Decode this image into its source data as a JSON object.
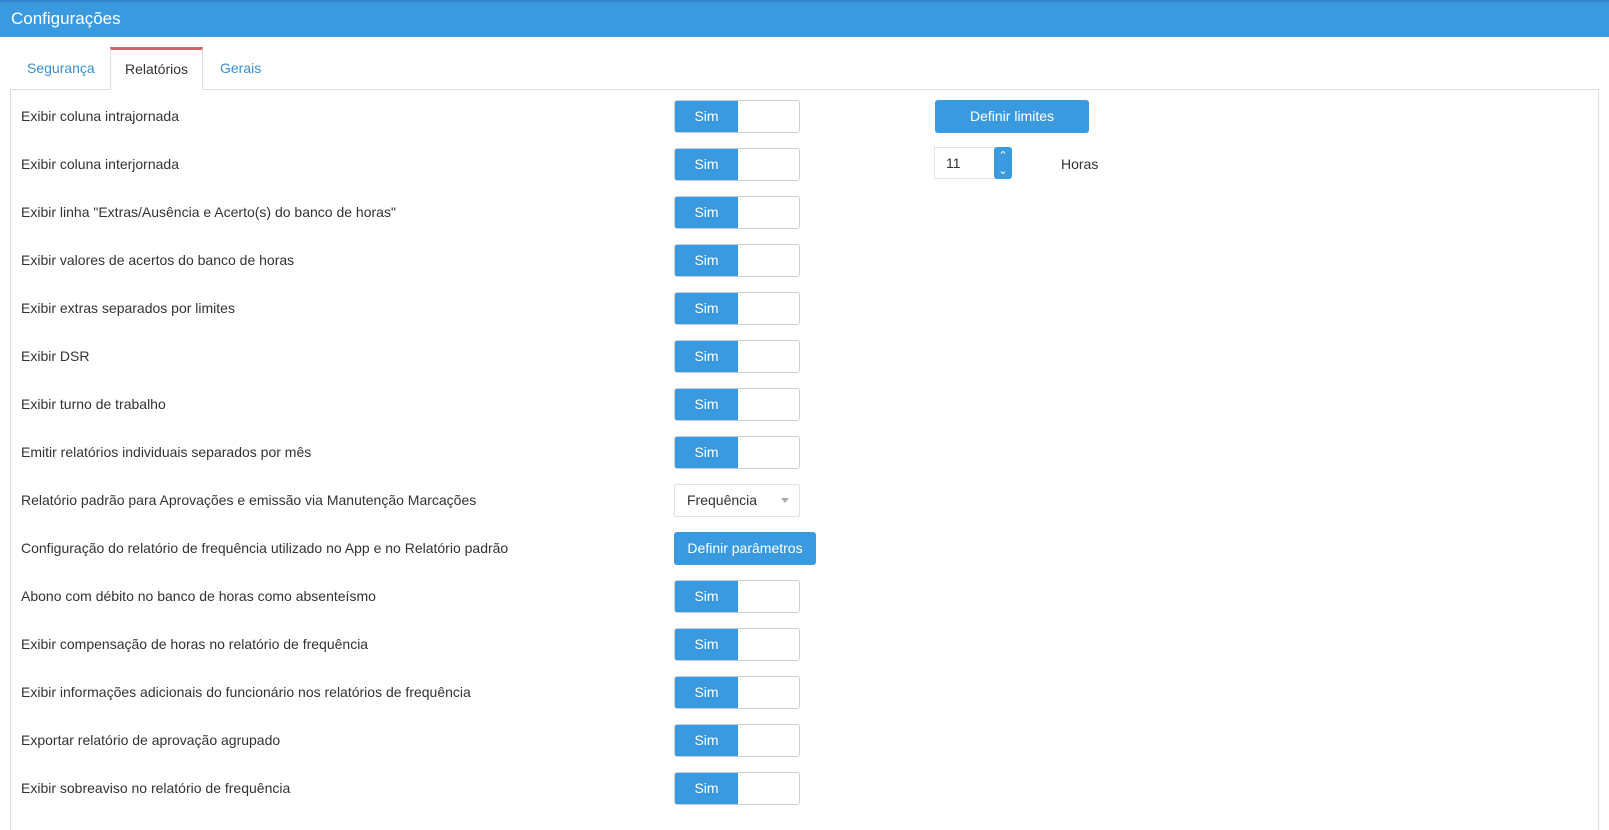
{
  "header": {
    "title": "Configurações"
  },
  "tabs": [
    {
      "label": "Segurança"
    },
    {
      "label": "Relatórios"
    },
    {
      "label": "Gerais"
    }
  ],
  "rows": [
    {
      "label": "Exibir coluna intrajornada",
      "toggle": "Sim",
      "extra_button": "Definir limites"
    },
    {
      "label": "Exibir coluna interjornada",
      "toggle": "Sim",
      "hours_value": "11",
      "hours_unit": "Horas"
    },
    {
      "label": "Exibir linha \"Extras/Ausência e Acerto(s) do banco de horas\"",
      "toggle": "Sim"
    },
    {
      "label": "Exibir valores de acertos do banco de horas",
      "toggle": "Sim"
    },
    {
      "label": "Exibir extras separados por limites",
      "toggle": "Sim"
    },
    {
      "label": "Exibir DSR",
      "toggle": "Sim"
    },
    {
      "label": "Exibir turno de trabalho",
      "toggle": "Sim"
    },
    {
      "label": "Emitir relatórios individuais separados por mês",
      "toggle": "Sim"
    },
    {
      "label": "Relatório padrão para Aprovações e emissão via Manutenção Marcações",
      "select_value": "Frequência"
    },
    {
      "label": "Configuração do relatório de frequência utilizado no App e no Relatório padrão",
      "button": "Definir parâmetros"
    },
    {
      "label": "Abono com débito no banco de horas como absenteísmo",
      "toggle": "Sim"
    },
    {
      "label": "Exibir compensação de horas no relatório de frequência",
      "toggle": "Sim"
    },
    {
      "label": "Exibir informações adicionais do funcionário nos relatórios de frequência",
      "toggle": "Sim"
    },
    {
      "label": "Exportar relatório de aprovação agrupado",
      "toggle": "Sim"
    },
    {
      "label": "Exibir sobreaviso no relatório de frequência",
      "toggle": "Sim"
    }
  ],
  "spinner": {
    "up_icon": "chevron-up-icon",
    "down_icon": "chevron-down-icon",
    "up_glyph": "⌃",
    "down_glyph": "⌄"
  },
  "colors": {
    "accent": "#3a9ae0",
    "active_tab_border": "#e05a68"
  }
}
